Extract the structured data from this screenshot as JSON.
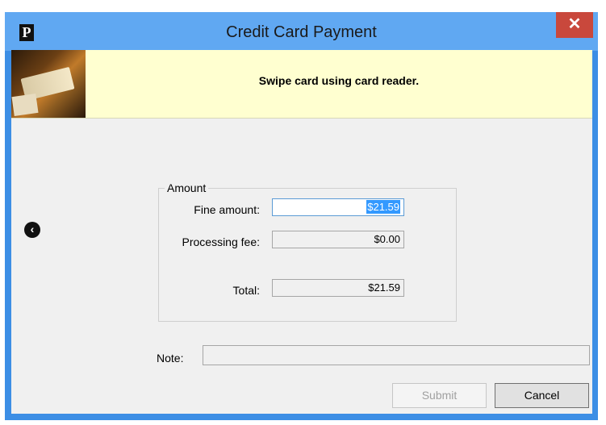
{
  "window": {
    "title": "Credit Card Payment",
    "app_logo": "P",
    "close_glyph": "✕"
  },
  "banner": {
    "message": "Swipe card using card reader."
  },
  "nav": {
    "back_glyph": "‹"
  },
  "amount": {
    "legend": "Amount",
    "fine_label": "Fine amount:",
    "fine_value": "$21.59",
    "fee_label": "Processing fee:",
    "fee_value": "$0.00",
    "total_label": "Total:",
    "total_value": "$21.59"
  },
  "note": {
    "label": "Note:",
    "value": ""
  },
  "buttons": {
    "submit": "Submit",
    "cancel": "Cancel"
  },
  "colors": {
    "title_bar": "#60a8f2",
    "window_frame": "#3c8ee5",
    "close_button": "#c9483c",
    "banner_bg": "#ffffd0",
    "selection": "#3399ff"
  }
}
